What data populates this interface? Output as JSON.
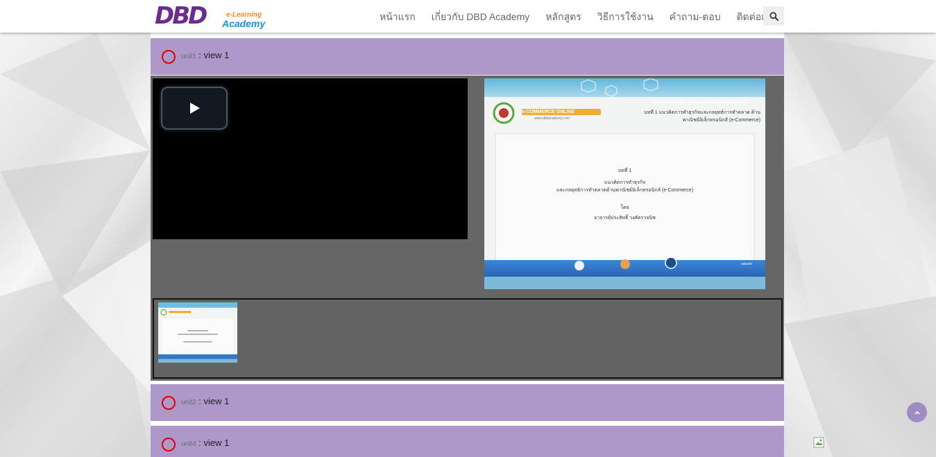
{
  "header": {
    "logo": {
      "main": "DBD",
      "sub1": "e-Learning",
      "sub2": "Academy"
    },
    "nav": [
      {
        "label": "หน้าแรก"
      },
      {
        "label": "เกี่ยวกับ DBD Academy"
      },
      {
        "label": "หลักสูตร"
      },
      {
        "label": "วิธีการใช้งาน"
      },
      {
        "label": "คำถาม-ตอบ"
      },
      {
        "label": "ติดต่อเรา"
      }
    ],
    "search_icon": "search-icon"
  },
  "units": [
    {
      "small": "unit1",
      "title": " : view 1"
    },
    {
      "small": "unit2",
      "title": " : view 1"
    },
    {
      "small": "unit4",
      "title": " : view 1"
    }
  ],
  "slide": {
    "brand": "e-COMMERCE ONLINE",
    "brand_url": "www.dbdacademy.com",
    "course_banner": "หลักสูตรการตลาดด้านพาณิชย์อิเล็กทรอนิกส์",
    "chapter_heading": "บทที่ 1 แนวคิดการทำธุรกิจและกลยุทธ์การทำตลาด ด้านพาณิชย์อิเล็กทรอนิกส์ (e-Commerce)",
    "lesson": "บทที่ 1",
    "topic_line1": "แนวคิดการทำธุรกิจ",
    "topic_line2": "และกลยุทธ์การทำตลาดด้านพาณิชย์อิเล็กทรอนิกส์ (e-Commerce)",
    "by": "โดย",
    "author": "อาจารย์ประสิทธิ์ วงศ์ตรวจนิช",
    "volume_label": "volume"
  },
  "colors": {
    "unit_bar": "#ad98c9",
    "status_circle": "#e00000",
    "panel": "#666666",
    "brand_purple": "#6a2c91"
  }
}
